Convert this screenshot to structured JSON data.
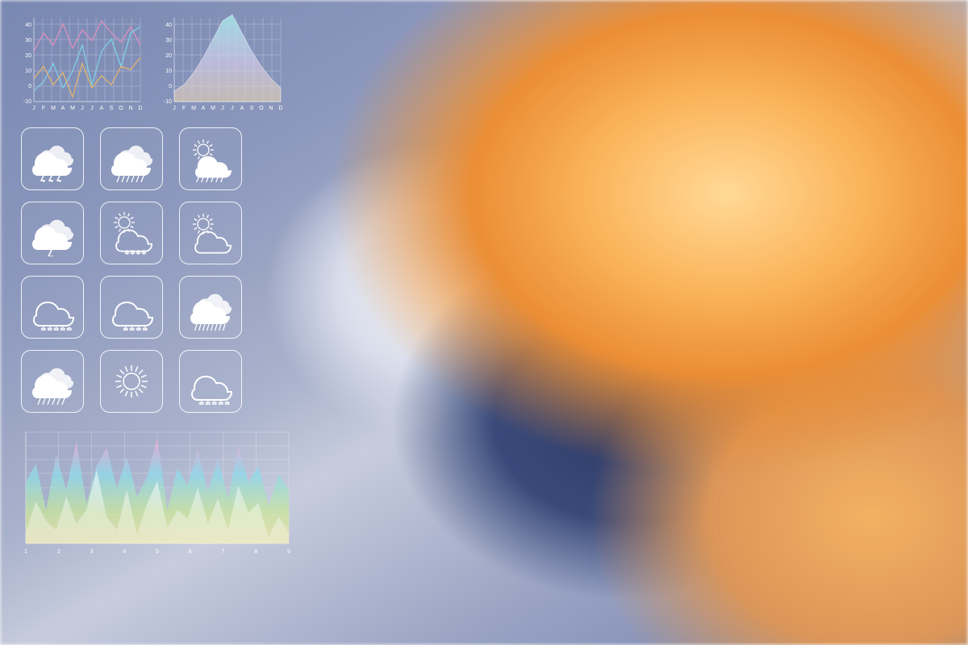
{
  "colors": {
    "line_magenta": "#e38fc0",
    "line_cyan": "#7fd4e9",
    "line_orange": "#e9b86b"
  },
  "months": [
    "J",
    "F",
    "M",
    "A",
    "M",
    "J",
    "J",
    "A",
    "S",
    "O",
    "N",
    "D"
  ],
  "icons": [
    {
      "name": "thunderstorm-icon",
      "style": "filled"
    },
    {
      "name": "showers-icon",
      "style": "filled"
    },
    {
      "name": "sun-showers-icon",
      "style": "filled"
    },
    {
      "name": "lightning-icon",
      "style": "filled"
    },
    {
      "name": "partly-cloudy-snow-icon",
      "style": "outline"
    },
    {
      "name": "partly-cloudy-icon",
      "style": "outline"
    },
    {
      "name": "snow-icon",
      "style": "outline"
    },
    {
      "name": "sleet-icon",
      "style": "outline"
    },
    {
      "name": "heavy-rain-icon",
      "style": "filled"
    },
    {
      "name": "rain-icon",
      "style": "filled"
    },
    {
      "name": "sunny-icon",
      "style": "outline"
    },
    {
      "name": "cloud-snow-icon",
      "style": "outline"
    }
  ],
  "chart_data": [
    {
      "id": "top-left-line",
      "type": "line",
      "categories": [
        "J",
        "F",
        "M",
        "A",
        "M",
        "J",
        "J",
        "A",
        "S",
        "O",
        "N",
        "D"
      ],
      "y_ticks": [
        -10,
        0,
        10,
        20,
        30,
        40
      ],
      "ylim": [
        -15,
        40
      ],
      "series": [
        {
          "name": "magenta",
          "color": "#e38fc0",
          "values": [
            18,
            30,
            22,
            36,
            20,
            32,
            25,
            38,
            30,
            24,
            34,
            22
          ]
        },
        {
          "name": "cyan",
          "color": "#7fd4e9",
          "values": [
            -8,
            -2,
            10,
            -6,
            5,
            22,
            -4,
            18,
            26,
            8,
            30,
            34
          ]
        },
        {
          "name": "orange",
          "color": "#e9b86b",
          "values": [
            0,
            8,
            -4,
            4,
            -12,
            10,
            -6,
            2,
            -4,
            8,
            6,
            14
          ]
        }
      ]
    },
    {
      "id": "top-right-area",
      "type": "area",
      "categories": [
        "J",
        "F",
        "M",
        "A",
        "M",
        "J",
        "J",
        "A",
        "S",
        "O",
        "N",
        "D"
      ],
      "y_ticks": [
        -10,
        0,
        10,
        20,
        30,
        40
      ],
      "ylim": [
        -15,
        40
      ],
      "series": [
        {
          "name": "area",
          "values": [
            -8,
            -4,
            4,
            14,
            26,
            38,
            42,
            30,
            18,
            8,
            0,
            -6
          ]
        }
      ]
    },
    {
      "id": "bottom-area",
      "type": "area",
      "x_ticks": [
        "1",
        "2",
        "3",
        "4",
        "5",
        "6",
        "7",
        "8",
        "9"
      ],
      "ylim": [
        0,
        100
      ],
      "series": [
        {
          "name": "back",
          "values": [
            55,
            72,
            30,
            80,
            48,
            92,
            35,
            70,
            86,
            50,
            78,
            42,
            60,
            95,
            30,
            68,
            52,
            85,
            46,
            76,
            40,
            88,
            55,
            70,
            34,
            62,
            48
          ]
        },
        {
          "name": "front",
          "values": [
            10,
            38,
            20,
            12,
            42,
            18,
            30,
            66,
            24,
            12,
            48,
            8,
            36,
            56,
            14,
            30,
            22,
            50,
            18,
            40,
            12,
            52,
            28,
            36,
            6,
            24,
            10
          ]
        }
      ]
    }
  ]
}
